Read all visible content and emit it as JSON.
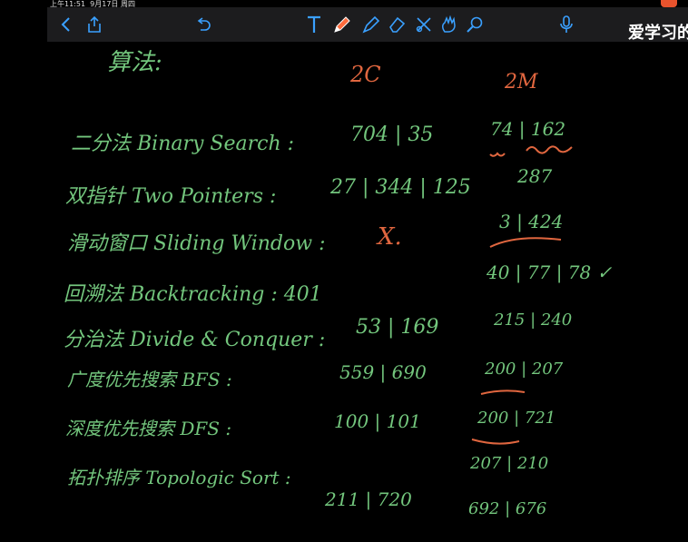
{
  "status": {
    "time": "上午11:51",
    "date": "9月17日 周四"
  },
  "toolbar": {
    "tools": [
      "back-icon",
      "share-icon",
      "undo-icon",
      "text-tool-icon",
      "pen-icon",
      "highlighter-icon",
      "eraser-icon",
      "lasso-icon",
      "hand-icon",
      "zoom-icon",
      "microphone-icon"
    ],
    "active_tool": "pen-icon",
    "accent": "#3aa0ff",
    "pen_color": "#ff6b3d"
  },
  "brand": "爱学习的",
  "note": {
    "heading": "算法:",
    "col1_header": "2C",
    "col2_header": "2M",
    "rows": [
      {
        "topic": "二分法 Binary Search :",
        "col1": "704 | 35",
        "col2": "74 | 162"
      },
      {
        "topic": "双指针 Two Pointers :",
        "col1": "27 | 344 | 125",
        "col2": "287"
      },
      {
        "topic": "滑动窗口 Sliding Window :",
        "col1": "X.",
        "col2": "3 | 424"
      },
      {
        "topic": "回溯法 Backtracking : 401",
        "col1": "",
        "col2": "40 | 77 | 78 ✓"
      },
      {
        "topic": "分治法 Divide & Conquer :",
        "col1": "53 | 169",
        "col2": "215 | 240"
      },
      {
        "topic": "广度优先搜索 BFS :",
        "col1": "559 | 690",
        "col2": "200 | 207"
      },
      {
        "topic": "深度优先搜索 DFS :",
        "col1": "100 | 101",
        "col2": "200 | 721"
      },
      {
        "topic": "拓扑排序 Topologic Sort :",
        "col1": "",
        "col2": "207 | 210"
      },
      {
        "topic": "",
        "col1": "211 | 720",
        "col2": "692 | 676"
      }
    ],
    "ink_green": "#73c67d",
    "ink_red": "#e0663f"
  }
}
